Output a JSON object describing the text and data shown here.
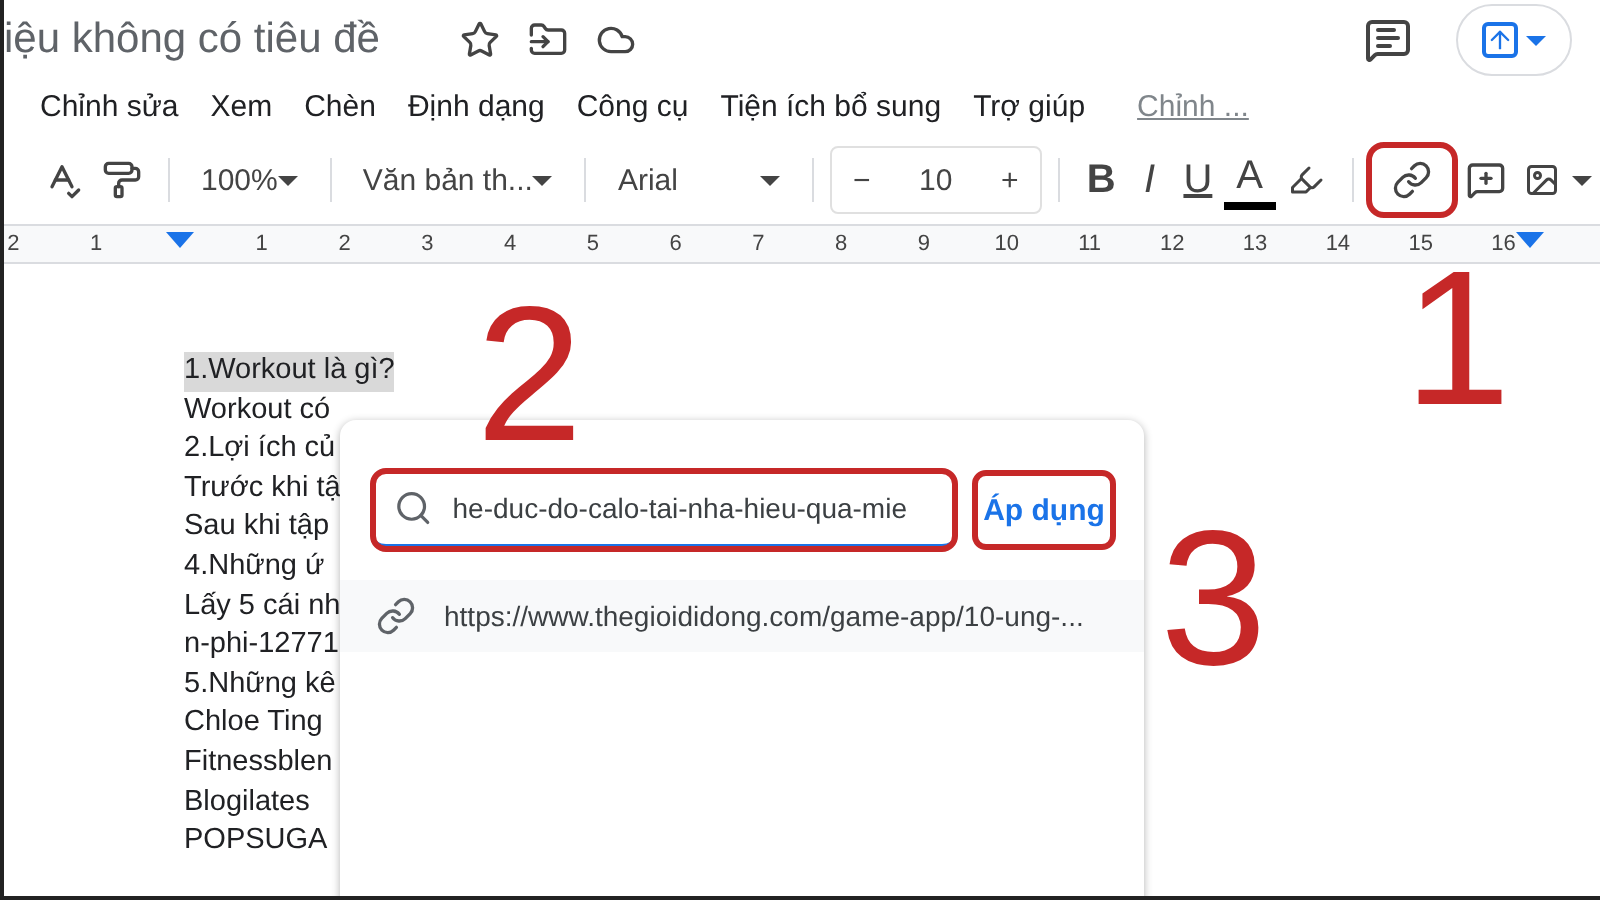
{
  "title_bar": {
    "title": "iệu không có tiêu đề"
  },
  "menu": [
    "Chỉnh sửa",
    "Xem",
    "Chèn",
    "Định dạng",
    "Công cụ",
    "Tiện ích bổ sung",
    "Trợ giúp"
  ],
  "last_edit": "Chỉnh ...",
  "toolbar": {
    "zoom": "100%",
    "style": "Văn bản th...",
    "font": "Arial",
    "font_size": "10",
    "minus": "−",
    "plus": "+",
    "format_buttons": [
      {
        "label": "B",
        "kind": "bold"
      },
      {
        "label": "I",
        "kind": "italic"
      },
      {
        "label": "U",
        "kind": "underline"
      },
      {
        "label": "A",
        "kind": "color"
      }
    ],
    "link_button": {
      "annotated": true
    }
  },
  "ruler": [
    "2",
    "1",
    "1",
    "2",
    "3",
    "4",
    "5",
    "6",
    "7",
    "8",
    "9",
    "10",
    "11",
    "12",
    "13",
    "14",
    "15",
    "16"
  ],
  "document_lines": [
    {
      "text": "1.Workout là gì?",
      "highlighted": true
    },
    {
      "text": "Workout có",
      "highlighted": false
    },
    {
      "text": "2.Lợi ích củ",
      "highlighted": false
    },
    {
      "text": "Trước khi tậ",
      "highlighted": false
    },
    {
      "text": "Sau khi tập",
      "highlighted": false
    },
    {
      "text": "4.Những ứ",
      "highlighted": false
    },
    {
      "text": "Lấy 5 cái nh",
      "highlighted": false
    },
    {
      "text": "n-phi-12771",
      "highlighted": false
    },
    {
      "text": "5.Những kê",
      "highlighted": false
    },
    {
      "text": "Chloe Ting",
      "highlighted": false
    },
    {
      "text": "Fitnessblen",
      "highlighted": false
    },
    {
      "text": "Blogilates",
      "highlighted": false
    },
    {
      "text": "POPSUGA",
      "highlighted": false
    }
  ],
  "link_popup": {
    "search": {
      "value": "he-duc-do-calo-tai-nha-hieu-qua-mie",
      "annotated": true
    },
    "apply_button": {
      "label": "Áp dụng",
      "annotated": true
    },
    "suggestions": [
      "https://www.thegioididong.com/game-app/10-ung-..."
    ]
  },
  "annotations": [
    {
      "label": "2",
      "kind": "number"
    },
    {
      "label": "1",
      "kind": "number"
    },
    {
      "label": "3",
      "kind": "number"
    }
  ]
}
